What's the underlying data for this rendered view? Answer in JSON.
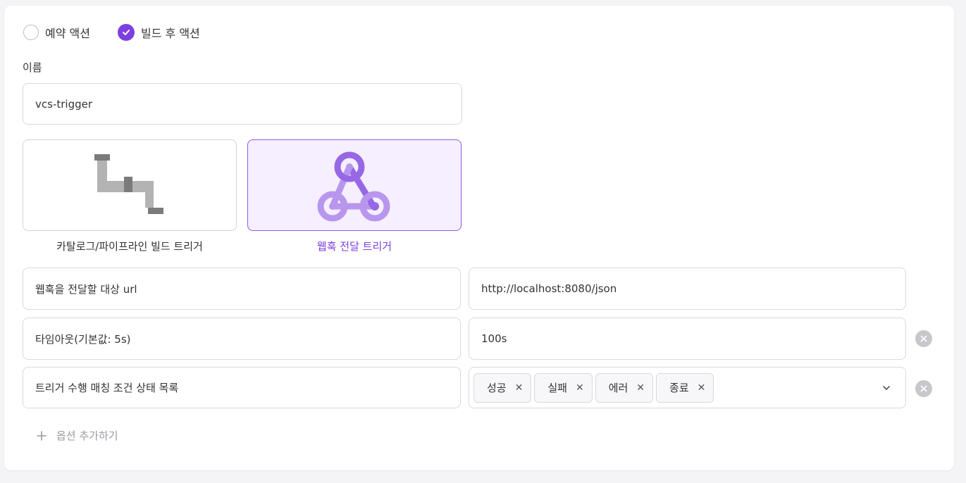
{
  "action_type": {
    "options": [
      {
        "label": "예약 액션",
        "selected": false
      },
      {
        "label": "빌드 후 액션",
        "selected": true
      }
    ]
  },
  "name_field": {
    "label": "이름",
    "value": "vcs-trigger"
  },
  "trigger_types": [
    {
      "label": "카탈로그/파이프라인 빌드 트리거",
      "icon": "pipeline-icon",
      "selected": false
    },
    {
      "label": "웹훅 전달 트리거",
      "icon": "webhook-icon",
      "selected": true
    }
  ],
  "options": [
    {
      "key": "웹훅을 전달할 대상 url",
      "value": "http://localhost:8080/json",
      "removable": false
    },
    {
      "key": "타임아웃(기본값: 5s)",
      "value": "100s",
      "removable": true
    },
    {
      "key": "트리거 수행 매칭 조건 상태 목록",
      "tags": [
        "성공",
        "실패",
        "에러",
        "종료"
      ],
      "removable": true
    }
  ],
  "add_option_label": "옵션 추가하기",
  "colors": {
    "accent": "#7d3fe0",
    "selected_bg": "#f5efff",
    "border": "#d9d9de"
  }
}
